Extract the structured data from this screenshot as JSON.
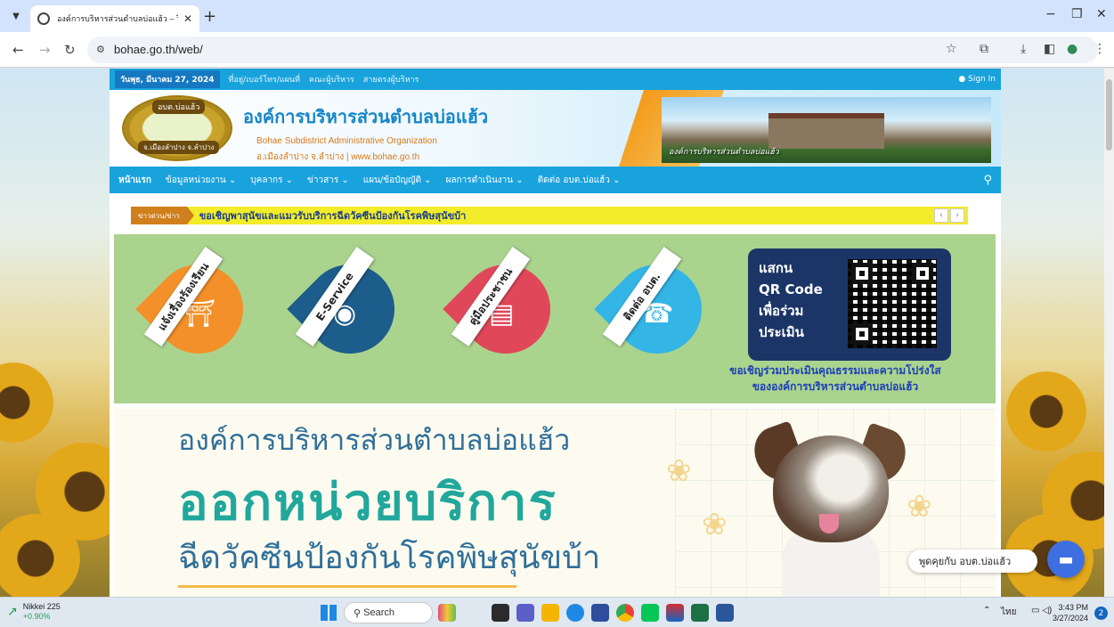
{
  "browser": {
    "tab_title": "องค์การบริหารส่วนตำบลบ่อแฮ้ว – วิสัย",
    "url": "bohae.go.th/web/"
  },
  "site": {
    "date": "วันพุธ, มีนาคม 27, 2024",
    "toplinks": [
      "ที่อยู่/เบอร์โทร/แผนที่",
      "คณะผู้บริหาร",
      "สายตรงผู้บริหาร"
    ],
    "signin": "Sign In",
    "title": "องค์การบริหารส่วนตำบลบ่อแฮ้ว",
    "subtitle_en": "Bohae Subdistrict Administrative Organization",
    "subtitle_th": "อ.เมืองลำปาง จ.ลำปาง | www.bohae.go.th",
    "logo_top": "อบต.บ่อแฮ้ว",
    "logo_bottom": "จ.เมืองลำปาง จ.ลำปาง",
    "photo_caption": "องค์การบริหารส่วนตำบลบ่อแฮ้ว",
    "nav": [
      "หน้าแรก",
      "ข้อมูลหน่วยงาน ⌄",
      "บุคลากร ⌄",
      "ข่าวสาร ⌄",
      "แผน/ข้อบัญญัติ ⌄",
      "ผลการดำเนินงาน ⌄",
      "ติดต่อ อบต.บ่อแฮ้ว ⌄"
    ],
    "news_label": "ข่าวด่วน/ข่าว",
    "news_text": "ขอเชิญพาสุนัขและแมวรับบริการฉีดวัคซีนป้องกันโรคพิษสุนัขบ้า",
    "services": [
      {
        "label": "แจ้งเรื่องร้องเรียน",
        "color": "#f3902a",
        "glyph": "⛩"
      },
      {
        "label": "E-Service",
        "color": "#1d5d8c",
        "glyph": "🌐"
      },
      {
        "label": "คู่มือประชาชน",
        "color": "#e0485a",
        "glyph": "📖"
      },
      {
        "label": "ติดต่อ อบต.",
        "color": "#33b5e5",
        "glyph": "☎"
      }
    ],
    "qr_lines": [
      "แสกน",
      "QR Code",
      "เพื่อร่วม",
      "ประเมิน"
    ],
    "qr_invite_1": "ขอเชิญร่วมประเมินคุณธรรมและความโปร่งใส",
    "qr_invite_2": "ขององค์การบริหารส่วนตำบลบ่อแฮ้ว",
    "banner_line1": "องค์การบริหารส่วนตำบลบ่อแฮ้ว",
    "banner_line2": "ออกหน่วยบริการ",
    "banner_line3": "ฉีดวัคซีนป้องกันโรคพิษสุนัขบ้า",
    "chat_label": "พูดคุยกับ อบต.บ่อแฮ้ว"
  },
  "taskbar": {
    "weather_title": "Nikkei 225",
    "weather_value": "+0.90%",
    "search": "Search",
    "lang": "ไทย",
    "time": "3:43 PM",
    "date": "3/27/2024",
    "notifications": "2"
  }
}
